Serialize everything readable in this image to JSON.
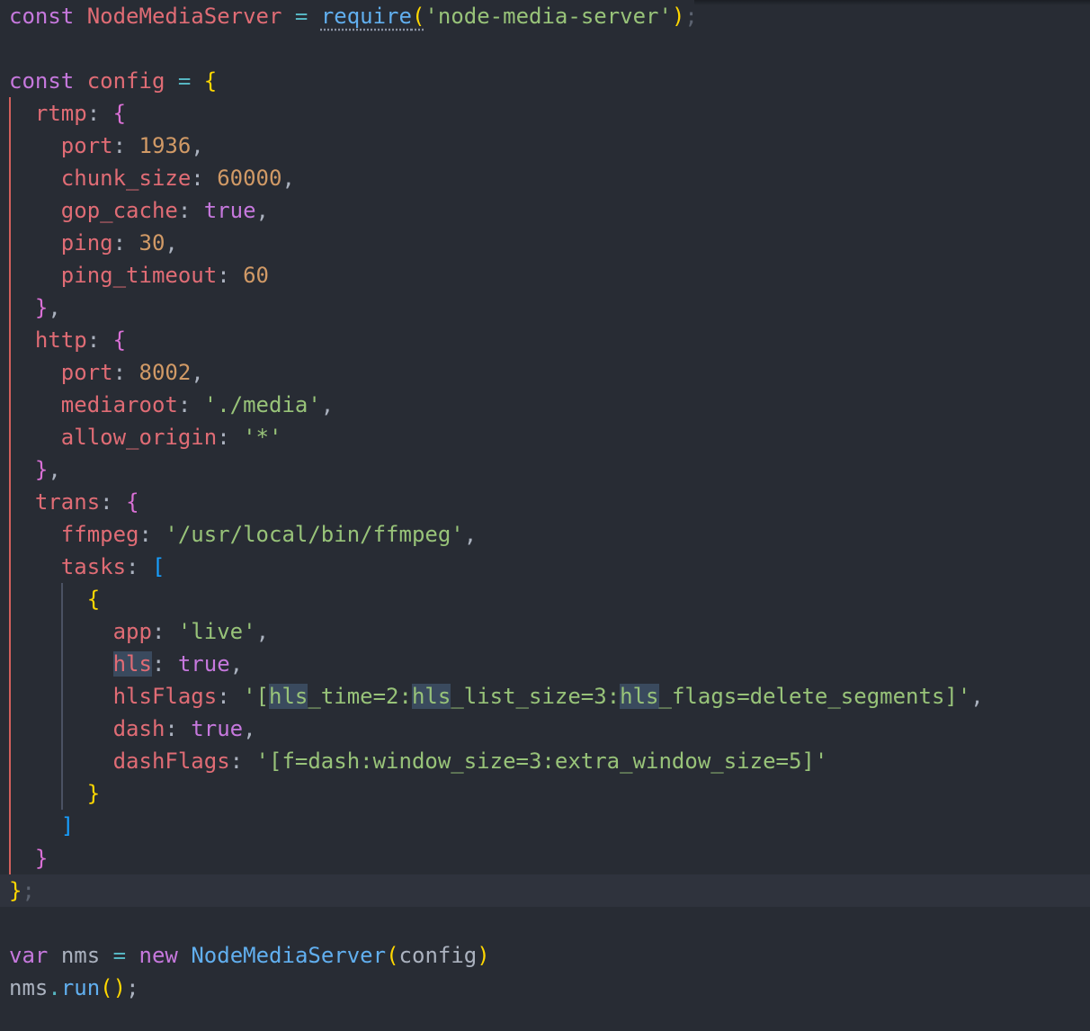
{
  "editor": {
    "lines": {
      "l1": {
        "kw": "const",
        "name": "NodeMediaServer",
        "eq": "=",
        "fn": "require",
        "open": "(",
        "str": "'node-media-server'",
        "close": ")",
        "semi": ";"
      },
      "l3": {
        "kw": "const",
        "name": "config",
        "eq": "=",
        "brace": "{"
      },
      "l4": {
        "prop": "rtmp",
        "colon": ":",
        "brace": "{"
      },
      "l5": {
        "prop": "port",
        "colon": ":",
        "val": "1936",
        "comma": ","
      },
      "l6": {
        "prop": "chunk_size",
        "colon": ":",
        "val": "60000",
        "comma": ","
      },
      "l7": {
        "prop": "gop_cache",
        "colon": ":",
        "val": "true",
        "comma": ","
      },
      "l8": {
        "prop": "ping",
        "colon": ":",
        "val": "30",
        "comma": ","
      },
      "l9": {
        "prop": "ping_timeout",
        "colon": ":",
        "val": "60"
      },
      "l10": {
        "brace": "}",
        "comma": ","
      },
      "l11": {
        "prop": "http",
        "colon": ":",
        "brace": "{"
      },
      "l12": {
        "prop": "port",
        "colon": ":",
        "val": "8002",
        "comma": ","
      },
      "l13": {
        "prop": "mediaroot",
        "colon": ":",
        "val": "'./media'",
        "comma": ","
      },
      "l14": {
        "prop": "allow_origin",
        "colon": ":",
        "val": "'*'"
      },
      "l15": {
        "brace": "}",
        "comma": ","
      },
      "l16": {
        "prop": "trans",
        "colon": ":",
        "brace": "{"
      },
      "l17": {
        "prop": "ffmpeg",
        "colon": ":",
        "val": "'/usr/local/bin/ffmpeg'",
        "comma": ","
      },
      "l18": {
        "prop": "tasks",
        "colon": ":",
        "bracket": "["
      },
      "l19": {
        "brace": "{"
      },
      "l20": {
        "prop": "app",
        "colon": ":",
        "val": "'live'",
        "comma": ","
      },
      "l21": {
        "prop": "hls",
        "colon": ":",
        "val": "true",
        "comma": ","
      },
      "l22": {
        "prop": "hlsFlags",
        "colon": ":",
        "s1": "'[",
        "h1": "hls",
        "s2": "_time=2:",
        "h2": "hls",
        "s3": "_list_size=3:",
        "h3": "hls",
        "s4": "_flags=delete_segments]'",
        "comma": ","
      },
      "l23": {
        "prop": "dash",
        "colon": ":",
        "val": "true",
        "comma": ","
      },
      "l24": {
        "prop": "dashFlags",
        "colon": ":",
        "val": "'[f=dash:window_size=3:extra_window_size=5]'"
      },
      "l25": {
        "brace": "}"
      },
      "l26": {
        "bracket": "]"
      },
      "l27": {
        "brace": "}"
      },
      "l28": {
        "brace": "}",
        "semi": ";"
      },
      "l30": {
        "kw": "var",
        "name": "nms",
        "eq": "=",
        "kw2": "new",
        "cls": "NodeMediaServer",
        "open": "(",
        "arg": "config",
        "close": ")"
      },
      "l31": {
        "obj": "nms",
        "dot": ".",
        "fn": "run",
        "open": "(",
        "close": ")",
        "semi": ";"
      }
    }
  },
  "colors": {
    "background": "#282c34",
    "keyword": "#c678dd",
    "property": "#e06c75",
    "number": "#d19a66",
    "string": "#98c379",
    "function": "#61afef"
  }
}
